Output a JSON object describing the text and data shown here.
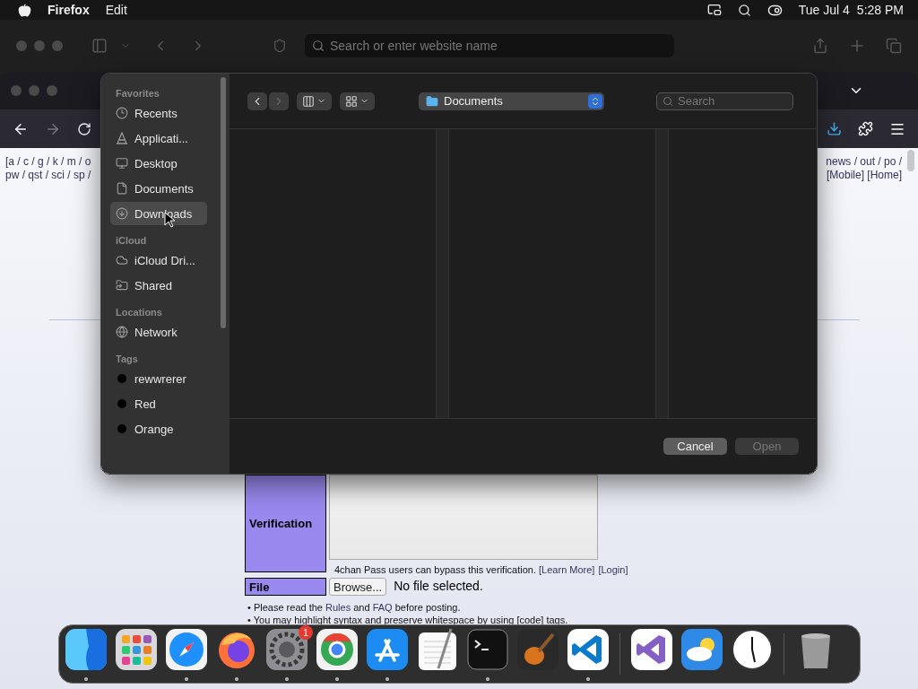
{
  "menu_bar": {
    "app": "Firefox",
    "items": [
      "Edit"
    ],
    "date": "Tue Jul 4",
    "time": "5:28 PM"
  },
  "background_window": {
    "address_placeholder": "Search or enter website name"
  },
  "browser": {
    "page": {
      "board_links_left": [
        "[a / c / g / k / m / o",
        "pw / qst / sci / sp /"
      ],
      "board_links_right": [
        "news / out / po /",
        "[Mobile] [Home]"
      ],
      "form_rows": [
        {
          "kind": "captcha",
          "label": "Verification",
          "note": [
            {
              "text": "4chan Pass users can bypass this verification. "
            },
            {
              "text": "[Learn More]",
              "link": true
            },
            {
              "text": "[Login]",
              "link": true
            }
          ]
        },
        {
          "kind": "file",
          "label": "File",
          "button": "Browse...",
          "status": "No file selected."
        }
      ],
      "notes": [
        [
          {
            "text": "• Please read the "
          },
          {
            "text": "Rules",
            "link": true
          },
          {
            "text": " and "
          },
          {
            "text": "FAQ",
            "link": true
          },
          {
            "text": " before posting."
          }
        ],
        [
          {
            "text": "• You may highlight syntax and preserve whitespace by using [code] tags."
          }
        ]
      ]
    }
  },
  "file_dialog": {
    "sidebar": [
      {
        "heading": "Favorites",
        "items": [
          {
            "label": "Recents",
            "kind": "clock",
            "selected": false
          },
          {
            "label": "Applicati...",
            "kind": "apps",
            "selected": false
          },
          {
            "label": "Desktop",
            "kind": "desktop",
            "selected": false
          },
          {
            "label": "Documents",
            "kind": "document",
            "selected": false
          },
          {
            "label": "Downloads",
            "kind": "download",
            "selected": true
          }
        ]
      },
      {
        "heading": "iCloud",
        "items": [
          {
            "label": "iCloud Dri...",
            "kind": "cloud",
            "selected": false
          },
          {
            "label": "Shared",
            "kind": "shared",
            "selected": false
          }
        ]
      },
      {
        "heading": "Locations",
        "items": [
          {
            "label": "Network",
            "kind": "globe",
            "selected": false
          }
        ]
      },
      {
        "heading": "Tags",
        "items": [
          {
            "label": "rewwrerer",
            "kind": "tag",
            "selected": false
          },
          {
            "label": "Red",
            "kind": "tag",
            "selected": false
          },
          {
            "label": "Orange",
            "kind": "tag",
            "selected": false
          }
        ]
      }
    ],
    "toolbar": {
      "back_disabled": false,
      "forward_disabled": true,
      "location": "Documents",
      "search_placeholder": "Search"
    },
    "buttons": [
      {
        "label": "Cancel",
        "disabled": false
      },
      {
        "label": "Open",
        "disabled": true
      }
    ]
  },
  "dock": {
    "sections": [
      {
        "apps": [
          {
            "kind": "finder",
            "running": true
          },
          {
            "kind": "launchpad",
            "running": false
          },
          {
            "kind": "safari",
            "running": true
          },
          {
            "kind": "firefox",
            "running": true
          },
          {
            "kind": "settings",
            "running": true,
            "badge": "1"
          },
          {
            "kind": "chrome",
            "running": true
          },
          {
            "kind": "appstore",
            "running": true
          },
          {
            "kind": "textedit",
            "running": false
          },
          {
            "kind": "terminal",
            "running": true
          },
          {
            "kind": "guitar",
            "running": false
          },
          {
            "kind": "vscode",
            "running": true
          }
        ]
      },
      {
        "apps": [
          {
            "kind": "vs",
            "running": false
          },
          {
            "kind": "weather",
            "running": false
          },
          {
            "kind": "clock",
            "running": false
          }
        ]
      },
      {
        "apps": [
          {
            "kind": "trash",
            "running": false
          }
        ]
      }
    ]
  }
}
